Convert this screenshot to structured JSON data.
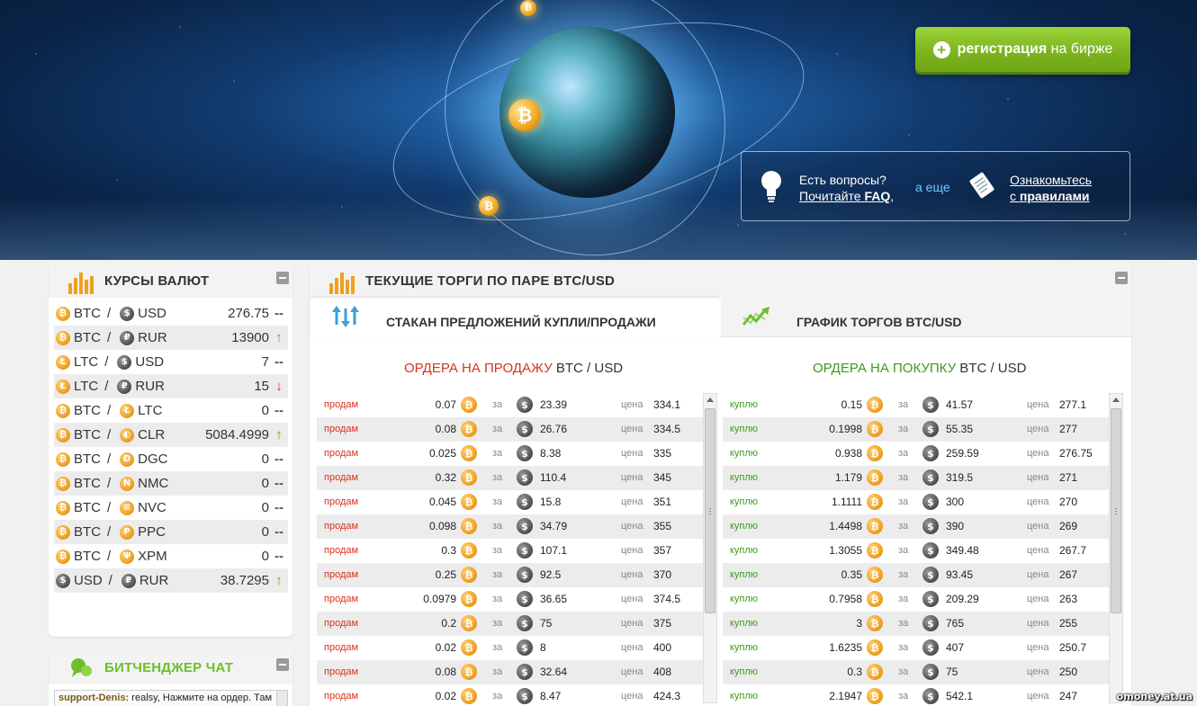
{
  "header": {
    "register_bold": "регистрация",
    "register_rest": "на бирже",
    "faq_question": "Есть вопросы?",
    "faq_read": "Почитайте",
    "faq_link": "FAQ",
    "faq_comma": ",",
    "faq_also": "а еще",
    "rules_line1": "Ознакомьтесь",
    "rules_prefix": "с",
    "rules_link": "правилами"
  },
  "rates": {
    "title": "КУРСЫ ВАЛЮТ",
    "rows": [
      {
        "from": "BTC",
        "from_icon": "bitcoin-coin-icon",
        "to": "USD",
        "to_icon": "dollar-coin-icon",
        "value": "276.75",
        "trend": "--",
        "trend_kind": "flat"
      },
      {
        "from": "BTC",
        "from_icon": "bitcoin-coin-icon",
        "to": "RUR",
        "to_icon": "ruble-coin-icon",
        "value": "13900",
        "trend": "↑",
        "trend_kind": "up"
      },
      {
        "from": "LTC",
        "from_icon": "litecoin-coin-icon",
        "to": "USD",
        "to_icon": "dollar-coin-icon",
        "value": "7",
        "trend": "--",
        "trend_kind": "flat"
      },
      {
        "from": "LTC",
        "from_icon": "litecoin-coin-icon",
        "to": "RUR",
        "to_icon": "ruble-coin-icon",
        "value": "15",
        "trend": "↓",
        "trend_kind": "down"
      },
      {
        "from": "BTC",
        "from_icon": "bitcoin-coin-icon",
        "to": "LTC",
        "to_icon": "litecoin-coin-icon",
        "value": "0",
        "trend": "--",
        "trend_kind": "flat"
      },
      {
        "from": "BTC",
        "from_icon": "bitcoin-coin-icon",
        "to": "CLR",
        "to_icon": "copperlark-coin-icon",
        "value": "5084.4999",
        "trend": "↑",
        "trend_kind": "up"
      },
      {
        "from": "BTC",
        "from_icon": "bitcoin-coin-icon",
        "to": "DGC",
        "to_icon": "digitalcoin-coin-icon",
        "value": "0",
        "trend": "--",
        "trend_kind": "flat"
      },
      {
        "from": "BTC",
        "from_icon": "bitcoin-coin-icon",
        "to": "NMC",
        "to_icon": "namecoin-coin-icon",
        "value": "0",
        "trend": "--",
        "trend_kind": "flat"
      },
      {
        "from": "BTC",
        "from_icon": "bitcoin-coin-icon",
        "to": "NVC",
        "to_icon": "novacoin-coin-icon",
        "value": "0",
        "trend": "--",
        "trend_kind": "flat"
      },
      {
        "from": "BTC",
        "from_icon": "bitcoin-coin-icon",
        "to": "PPC",
        "to_icon": "peercoin-coin-icon",
        "value": "0",
        "trend": "--",
        "trend_kind": "flat"
      },
      {
        "from": "BTC",
        "from_icon": "bitcoin-coin-icon",
        "to": "XPM",
        "to_icon": "primecoin-coin-icon",
        "value": "0",
        "trend": "--",
        "trend_kind": "flat"
      },
      {
        "from": "USD",
        "from_icon": "dollar-coin-icon",
        "to": "RUR",
        "to_icon": "ruble-coin-icon",
        "value": "38.7295",
        "trend": "↑",
        "trend_kind": "up"
      }
    ]
  },
  "chat": {
    "title": "БИТЧЕНДЖЕР ЧАТ",
    "message_user": "support-Denis:",
    "message_text": "realsy, Нажмите на ордер. Там"
  },
  "trades": {
    "title": "ТЕКУЩИЕ ТОРГИ ПО ПАРЕ BTC/USD",
    "tab_orderbook": "СТАКАН ПРЕДЛОЖЕНИЙ КУПЛИ/ПРОДАЖИ",
    "tab_chart": "ГРАФИК ТОРГОВ BTC/USD",
    "sell_title_red": "ОРДЕРА НА ПРОДАЖУ",
    "sell_title_pair": "BTC / USD",
    "buy_title_green": "ОРДЕРА НА ПОКУПКУ",
    "buy_title_pair": "BTC / USD",
    "za": "за",
    "price_label": "цена",
    "sell_kind": "продам",
    "buy_kind": "куплю",
    "sell_orders": [
      {
        "amount": "0.07",
        "total": "23.39",
        "price": "334.1"
      },
      {
        "amount": "0.08",
        "total": "26.76",
        "price": "334.5"
      },
      {
        "amount": "0.025",
        "total": "8.38",
        "price": "335"
      },
      {
        "amount": "0.32",
        "total": "110.4",
        "price": "345"
      },
      {
        "amount": "0.045",
        "total": "15.8",
        "price": "351"
      },
      {
        "amount": "0.098",
        "total": "34.79",
        "price": "355"
      },
      {
        "amount": "0.3",
        "total": "107.1",
        "price": "357"
      },
      {
        "amount": "0.25",
        "total": "92.5",
        "price": "370"
      },
      {
        "amount": "0.0979",
        "total": "36.65",
        "price": "374.5"
      },
      {
        "amount": "0.2",
        "total": "75",
        "price": "375"
      },
      {
        "amount": "0.02",
        "total": "8",
        "price": "400"
      },
      {
        "amount": "0.08",
        "total": "32.64",
        "price": "408"
      },
      {
        "amount": "0.02",
        "total": "8.47",
        "price": "424.3"
      }
    ],
    "buy_orders": [
      {
        "amount": "0.15",
        "total": "41.57",
        "price": "277.1"
      },
      {
        "amount": "0.1998",
        "total": "55.35",
        "price": "277"
      },
      {
        "amount": "0.938",
        "total": "259.59",
        "price": "276.75"
      },
      {
        "amount": "1.179",
        "total": "319.5",
        "price": "271"
      },
      {
        "amount": "1.1111",
        "total": "300",
        "price": "270"
      },
      {
        "amount": "1.4498",
        "total": "390",
        "price": "269"
      },
      {
        "amount": "1.3055",
        "total": "349.48",
        "price": "267.7"
      },
      {
        "amount": "0.35",
        "total": "93.45",
        "price": "267"
      },
      {
        "amount": "0.7958",
        "total": "209.29",
        "price": "263"
      },
      {
        "amount": "3",
        "total": "765",
        "price": "255"
      },
      {
        "amount": "1.6235",
        "total": "407",
        "price": "250.7"
      },
      {
        "amount": "0.3",
        "total": "75",
        "price": "250"
      },
      {
        "amount": "2.1947",
        "total": "542.1",
        "price": "247"
      }
    ]
  },
  "watermark": "omoney.at.ua",
  "colors": {
    "accent_green": "#7db51f",
    "sell_red": "#d8331f",
    "buy_green": "#3c9a1c",
    "coin_orange": "#eb9a1b"
  }
}
